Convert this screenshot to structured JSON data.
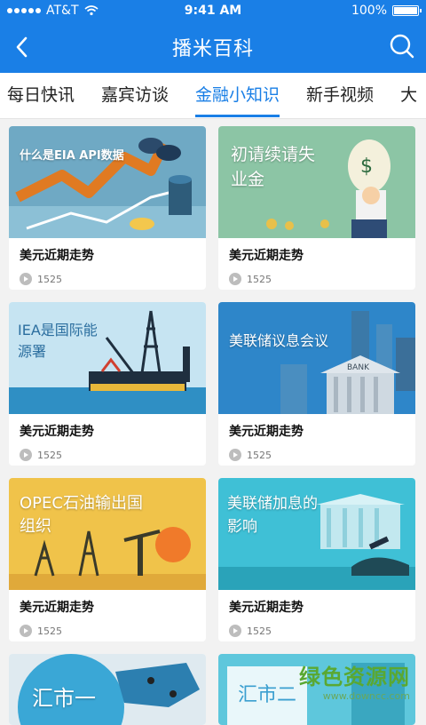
{
  "status": {
    "carrier": "AT&T",
    "time": "9:41 AM",
    "battery": "100%"
  },
  "nav": {
    "title": "播米百科"
  },
  "tabs": [
    {
      "label": "每日快讯"
    },
    {
      "label": "嘉宾访谈"
    },
    {
      "label": "金融小知识"
    },
    {
      "label": "新手视频"
    },
    {
      "label": "大"
    }
  ],
  "cards": [
    {
      "title": "美元近期走势",
      "count": "1525",
      "thumb": "什么是EIA API数据"
    },
    {
      "title": "美元近期走势",
      "count": "1525",
      "thumb": "初请续请失业金"
    },
    {
      "title": "美元近期走势",
      "count": "1525",
      "thumb": "IEA是国际能源署"
    },
    {
      "title": "美元近期走势",
      "count": "1525",
      "thumb": "美联储议息会议"
    },
    {
      "title": "美元近期走势",
      "count": "1525",
      "thumb": "OPEC石油输出国组织"
    },
    {
      "title": "美元近期走势",
      "count": "1525",
      "thumb": "美联储加息的影响"
    }
  ],
  "partial": [
    {
      "thumb": "汇市一"
    },
    {
      "thumb": "汇市二"
    }
  ],
  "watermark": {
    "main": "绿色资源网",
    "sub": "www.downcc.com"
  },
  "colors": {
    "primary": "#1a7fe6"
  }
}
